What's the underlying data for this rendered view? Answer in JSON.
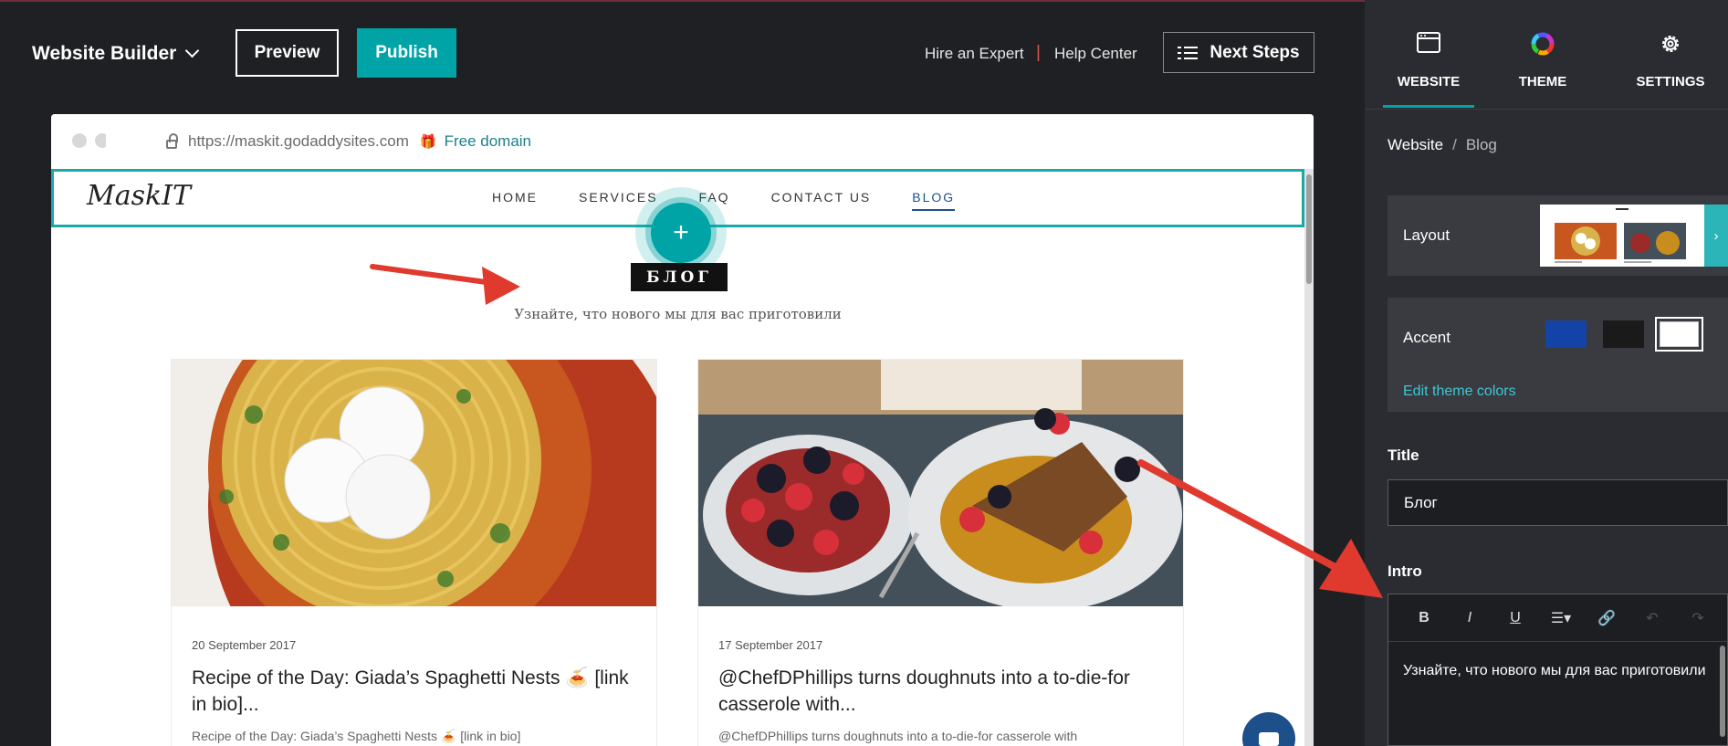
{
  "toolbar": {
    "brand": "Website Builder",
    "preview_label": "Preview",
    "publish_label": "Publish",
    "hire_expert": "Hire an Expert",
    "separator": "|",
    "help_center": "Help Center",
    "next_steps": "Next Steps"
  },
  "browser": {
    "url": "https://maskit.godaddysites.com",
    "free_domain": "Free domain"
  },
  "site": {
    "logo": "MaskIT",
    "nav": [
      "HOME",
      "SERVICES",
      "FAQ",
      "CONTACT US",
      "BLOG"
    ],
    "active_nav": "BLOG",
    "add_symbol": "+",
    "blog_title": "БЛОГ",
    "blog_intro": "Узнайте, что нового мы для вас приготовили",
    "posts": [
      {
        "date": "20 September 2017",
        "title": "Recipe of the Day: Giada’s Spaghetti Nests 🍝 [link in bio]...",
        "excerpt": "Recipe of the Day: Giada’s Spaghetti Nests 🍝 [link in bio]"
      },
      {
        "date": "17 September 2017",
        "title": "@ChefDPhillips turns doughnuts into a to-die-for casserole with...",
        "excerpt": "@ChefDPhillips turns doughnuts into a to-die-for casserole with"
      }
    ]
  },
  "panel": {
    "tabs": [
      {
        "label": "WEBSITE",
        "icon": "browser-window-icon"
      },
      {
        "label": "THEME",
        "icon": "color-wheel-icon"
      },
      {
        "label": "SETTINGS",
        "icon": "gear-icon"
      }
    ],
    "active_tab": "WEBSITE",
    "breadcrumb": {
      "root": "Website",
      "separator": "/",
      "current": "Blog"
    },
    "layout_label": "Layout",
    "accent_label": "Accent",
    "accent_colors": [
      "#1443a8",
      "#1a1a1a",
      "#ffffff"
    ],
    "edit_theme_colors": "Edit theme colors",
    "title_label": "Title",
    "title_value": "Блог",
    "intro_label": "Intro",
    "intro_value": "Узнайте, что нового мы для вас приготовили",
    "rte_buttons": [
      "B",
      "I",
      "U",
      "☰▾",
      "🔗",
      "↶",
      "↷"
    ]
  },
  "colors": {
    "accent": "#00a4a6",
    "arrow": "#e03a2f"
  }
}
